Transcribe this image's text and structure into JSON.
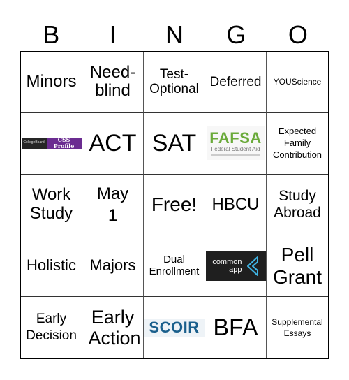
{
  "header": {
    "letters": [
      "B",
      "I",
      "N",
      "G",
      "O"
    ]
  },
  "cells": [
    {
      "text": "Minors"
    },
    {
      "text": "Need-blind"
    },
    {
      "text": "Test-Optional"
    },
    {
      "text": "Deferred"
    },
    {
      "text": "YOUScience"
    },
    {
      "logo": "css-profile",
      "brand": "CollegeBoard",
      "text": "CSS Profile",
      "colors": {
        "left": "#262626",
        "right": "#6b2c91"
      }
    },
    {
      "text": "ACT"
    },
    {
      "text": "SAT"
    },
    {
      "logo": "fafsa",
      "text": "FAFSA",
      "sub_text": "Federal Student Aid",
      "colors": {
        "primary": "#6aaa3a"
      }
    },
    {
      "text": "Expected Family Contribution"
    },
    {
      "text": "Work Study"
    },
    {
      "text": "May 1"
    },
    {
      "text": "Free!"
    },
    {
      "text": "HBCU"
    },
    {
      "text": "Study Abroad"
    },
    {
      "text": "Holistic"
    },
    {
      "text": "Majors"
    },
    {
      "text": "Dual Enrollment"
    },
    {
      "logo": "common-app",
      "text": "common app",
      "colors": {
        "bg": "#1f1f1f",
        "accent": "#3fb5e5"
      }
    },
    {
      "text": "Pell Grant"
    },
    {
      "text": "Early Decision"
    },
    {
      "text": "Early Action"
    },
    {
      "logo": "scoir",
      "text": "SCOIR",
      "colors": {
        "primary": "#1a5f8c"
      }
    },
    {
      "text": "BFA"
    },
    {
      "text": "Supplemental Essays"
    }
  ]
}
